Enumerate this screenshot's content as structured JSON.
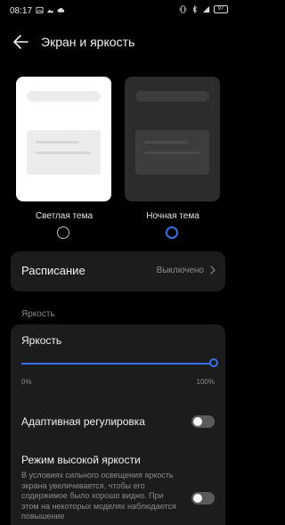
{
  "status_bar": {
    "time": "08:17",
    "battery": "97"
  },
  "header": {
    "title": "Экран и яркость"
  },
  "theme": {
    "light_label": "Светлая тема",
    "dark_label": "Ночная тема",
    "selected": "dark"
  },
  "schedule": {
    "label": "Расписание",
    "value": "Выключено"
  },
  "brightness_section": {
    "header": "Яркость",
    "label": "Яркость",
    "min_label": "0%",
    "max_label": "100%",
    "level": 1.0
  },
  "adaptive": {
    "label": "Адаптивная регулировка",
    "enabled": false
  },
  "high_brightness": {
    "label": "Режим высокой яркости",
    "description": "В условиях сильного освещения яркость экрана увеличивается, чтобы его содержимое было хорошо видно. При этом на некоторых моделях наблюдается повышение",
    "enabled": false
  },
  "colors": {
    "accent": "#3b6ee8",
    "background": "#000000",
    "card": "#1c1c1c"
  }
}
